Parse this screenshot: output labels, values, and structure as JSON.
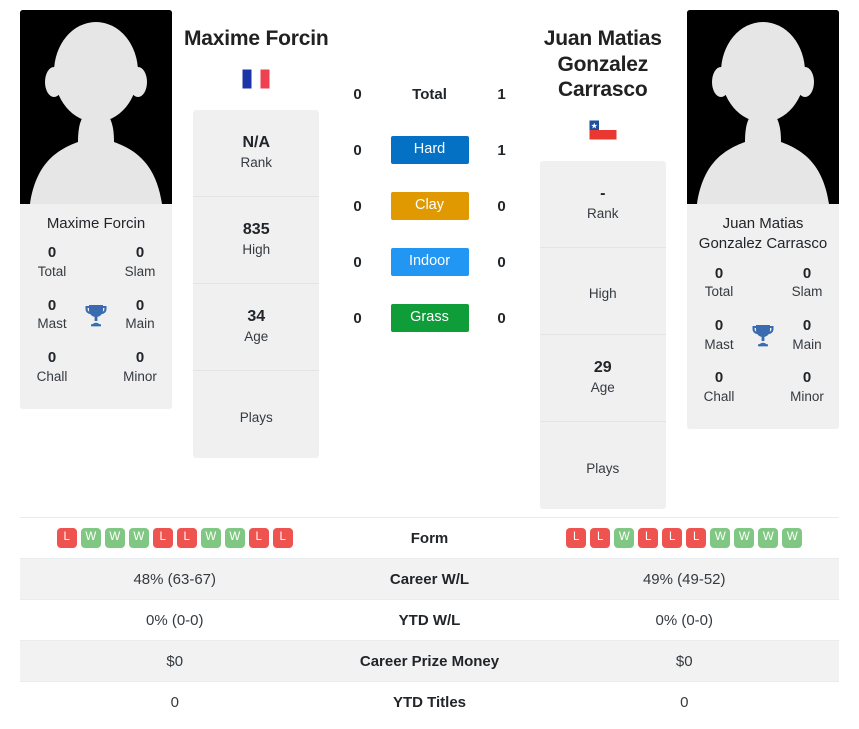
{
  "colors": {
    "win": "#81c784",
    "loss": "#ef5350",
    "hard": "#0571c4",
    "clay": "#e09900",
    "indoor": "#2196f3",
    "grass": "#0f9d3a",
    "trophy": "#3a6ab0",
    "card_bg": "#f0f0f0",
    "row_alt_bg": "#f2f2f2"
  },
  "player_left": {
    "name": "Maxime Forcin",
    "card_name": "Maxime Forcin",
    "country": "France",
    "flag": "flag-france",
    "titles": {
      "total_value": "0",
      "total_label": "Total",
      "slam_value": "0",
      "slam_label": "Slam",
      "mast_value": "0",
      "mast_label": "Mast",
      "main_value": "0",
      "main_label": "Main",
      "chall_value": "0",
      "chall_label": "Chall",
      "minor_value": "0",
      "minor_label": "Minor"
    },
    "stats": [
      {
        "value": "N/A",
        "label": "Rank"
      },
      {
        "value": "835",
        "label": "High"
      },
      {
        "value": "34",
        "label": "Age"
      },
      {
        "value": "",
        "label": "Plays"
      }
    ],
    "form": [
      "L",
      "W",
      "W",
      "W",
      "L",
      "L",
      "W",
      "W",
      "L",
      "L"
    ],
    "career_wl": "48% (63-67)",
    "ytd_wl": "0% (0-0)",
    "career_prize_money": "$0",
    "ytd_titles": "0"
  },
  "player_right": {
    "name": "Juan Matias Gonzalez Carrasco",
    "card_name": "Juan Matias Gonzalez Carrasco",
    "country": "Chile",
    "flag": "flag-chile",
    "titles": {
      "total_value": "0",
      "total_label": "Total",
      "slam_value": "0",
      "slam_label": "Slam",
      "mast_value": "0",
      "mast_label": "Mast",
      "main_value": "0",
      "main_label": "Main",
      "chall_value": "0",
      "chall_label": "Chall",
      "minor_value": "0",
      "minor_label": "Minor"
    },
    "stats": [
      {
        "value": "-",
        "label": "Rank"
      },
      {
        "value": "",
        "label": "High"
      },
      {
        "value": "29",
        "label": "Age"
      },
      {
        "value": "",
        "label": "Plays"
      }
    ],
    "form": [
      "L",
      "L",
      "W",
      "L",
      "L",
      "L",
      "W",
      "W",
      "W",
      "W"
    ],
    "career_wl": "49% (49-52)",
    "ytd_wl": "0% (0-0)",
    "career_prize_money": "$0",
    "ytd_titles": "0"
  },
  "head_to_head": [
    {
      "label": "Total",
      "left": "0",
      "right": "1",
      "type": "total"
    },
    {
      "label": "Hard",
      "left": "0",
      "right": "1",
      "type": "surface",
      "color": "#0571c4"
    },
    {
      "label": "Clay",
      "left": "0",
      "right": "0",
      "type": "surface",
      "color": "#e09900"
    },
    {
      "label": "Indoor",
      "left": "0",
      "right": "0",
      "type": "surface",
      "color": "#2196f3"
    },
    {
      "label": "Grass",
      "left": "0",
      "right": "0",
      "type": "surface",
      "color": "#0f9d3a"
    }
  ],
  "comparison_rows": [
    {
      "label": "Form",
      "left": "",
      "right": ""
    },
    {
      "label": "Career W/L",
      "left": "48% (63-67)",
      "right": "49% (49-52)"
    },
    {
      "label": "YTD W/L",
      "left": "0% (0-0)",
      "right": "0% (0-0)"
    },
    {
      "label": "Career Prize Money",
      "left": "$0",
      "right": "$0"
    },
    {
      "label": "YTD Titles",
      "left": "0",
      "right": "0"
    }
  ]
}
